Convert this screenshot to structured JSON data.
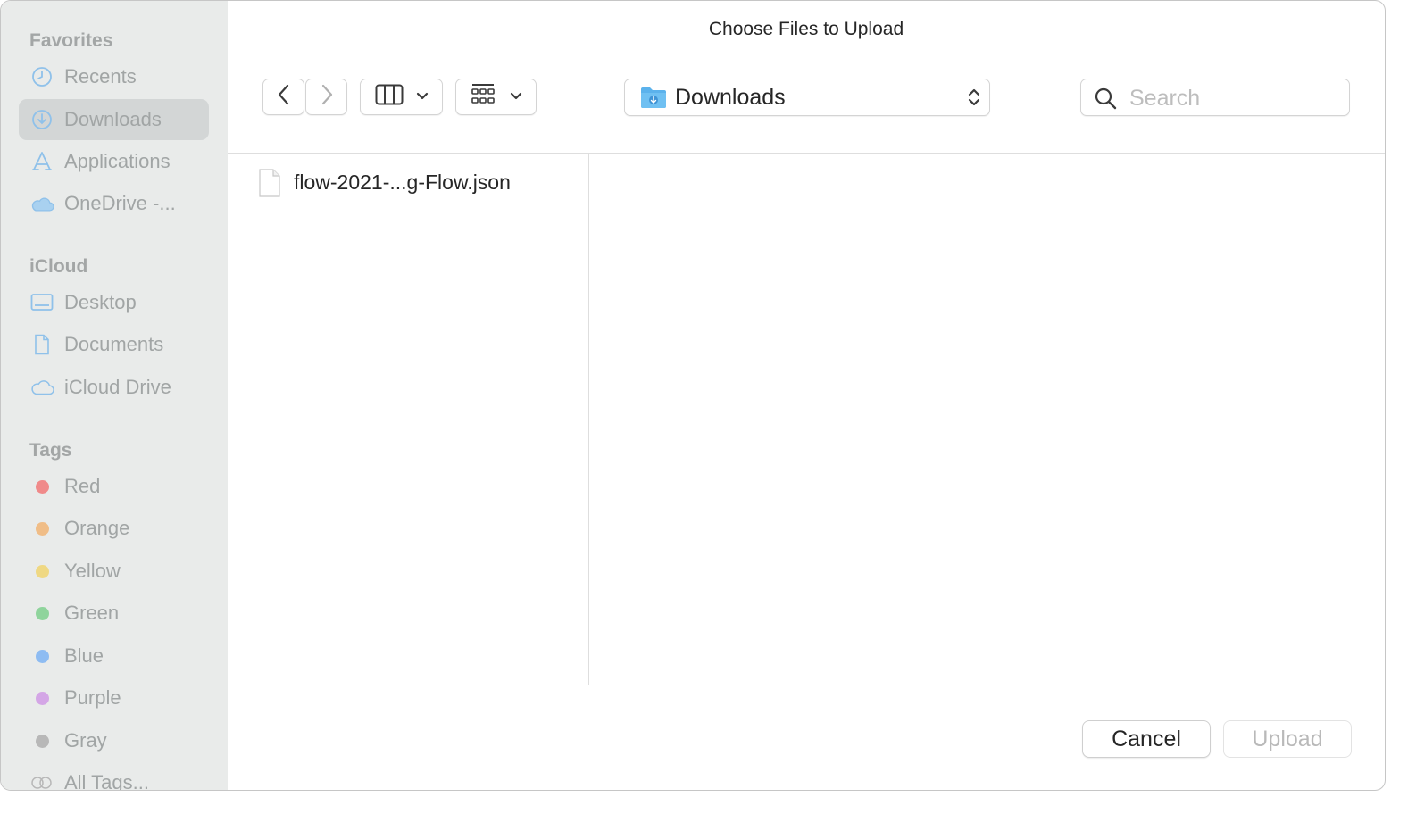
{
  "dialog": {
    "title": "Choose Files to Upload"
  },
  "sidebar": {
    "favorites_title": "Favorites",
    "favorites": [
      {
        "label": "Recents",
        "icon": "clock-icon"
      },
      {
        "label": "Downloads",
        "icon": "download-icon",
        "selected": true
      },
      {
        "label": "Applications",
        "icon": "applications-icon"
      },
      {
        "label": "OneDrive -...",
        "icon": "cloud-icon"
      }
    ],
    "icloud_title": "iCloud",
    "icloud": [
      {
        "label": "Desktop",
        "icon": "desktop-icon"
      },
      {
        "label": "Documents",
        "icon": "document-icon"
      },
      {
        "label": "iCloud Drive",
        "icon": "cloud-outline-icon"
      }
    ],
    "tags_title": "Tags",
    "tags": [
      {
        "label": "Red",
        "color": "#f08a8a"
      },
      {
        "label": "Orange",
        "color": "#f0bd87"
      },
      {
        "label": "Yellow",
        "color": "#efd883"
      },
      {
        "label": "Green",
        "color": "#8fd49c"
      },
      {
        "label": "Blue",
        "color": "#8ebcf2"
      },
      {
        "label": "Purple",
        "color": "#d4a6e6"
      },
      {
        "label": "Gray",
        "color": "#b8b8b8"
      },
      {
        "label": "All Tags...",
        "icon": "all-tags-icon"
      }
    ]
  },
  "toolbar": {
    "location": "Downloads",
    "search_placeholder": "Search"
  },
  "files": [
    {
      "name": "flow-2021-...g-Flow.json",
      "icon": "document-icon"
    }
  ],
  "buttons": {
    "cancel": "Cancel",
    "upload": "Upload"
  },
  "colors": {
    "accent": "#4aa3e3",
    "sidebar_bg": "#e9ebea"
  }
}
